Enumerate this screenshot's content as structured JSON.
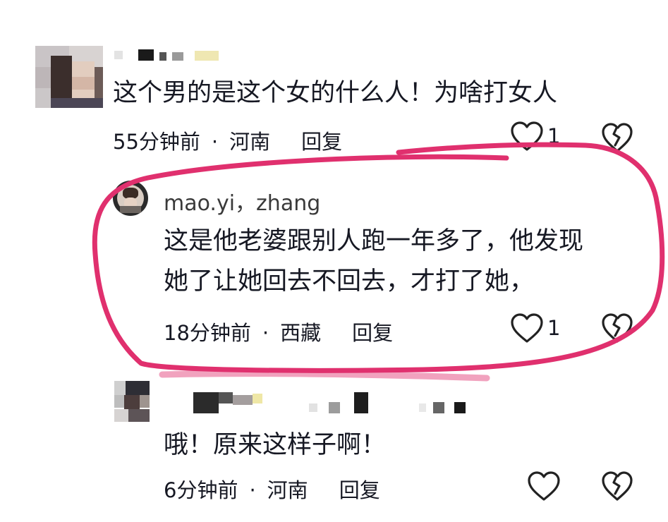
{
  "comments": [
    {
      "text": "这个男的是这个女的什么人！为啥打女人",
      "time": "55分钟前",
      "location": "河南",
      "reply_label": "回复",
      "likes": "1"
    },
    {
      "username": "mao.yi，zhang",
      "line1": "这是他老婆跟别人跑一年多了，他发现",
      "line2": "她了让她回去不回去，才打了她，",
      "time": "18分钟前",
      "location": "西藏",
      "reply_label": "回复",
      "likes": "1"
    },
    {
      "text": "哦！原来这样子啊！",
      "time": "6分钟前",
      "location": "河南",
      "reply_label": "回复"
    }
  ],
  "separator": "·",
  "annotation_color": "#e0306e",
  "icons": [
    "heart-icon",
    "dislike-icon"
  ]
}
